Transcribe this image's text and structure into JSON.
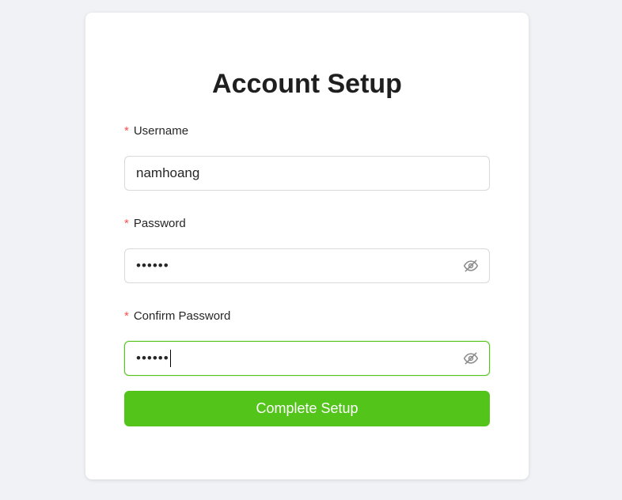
{
  "form": {
    "title": "Account Setup",
    "required_mark": "*",
    "username": {
      "label": "Username",
      "value": "namhoang"
    },
    "password": {
      "label": "Password",
      "value": "••••••",
      "toggle_icon": "eye-slash-icon"
    },
    "confirm_password": {
      "label": "Confirm Password",
      "value": "••••••",
      "toggle_icon": "eye-slash-icon",
      "focused": true
    },
    "submit_label": "Complete Setup"
  },
  "colors": {
    "page_background": "#f0f2f5",
    "card_background": "#ffffff",
    "primary": "#52c41a",
    "required": "#ff4d4f"
  }
}
